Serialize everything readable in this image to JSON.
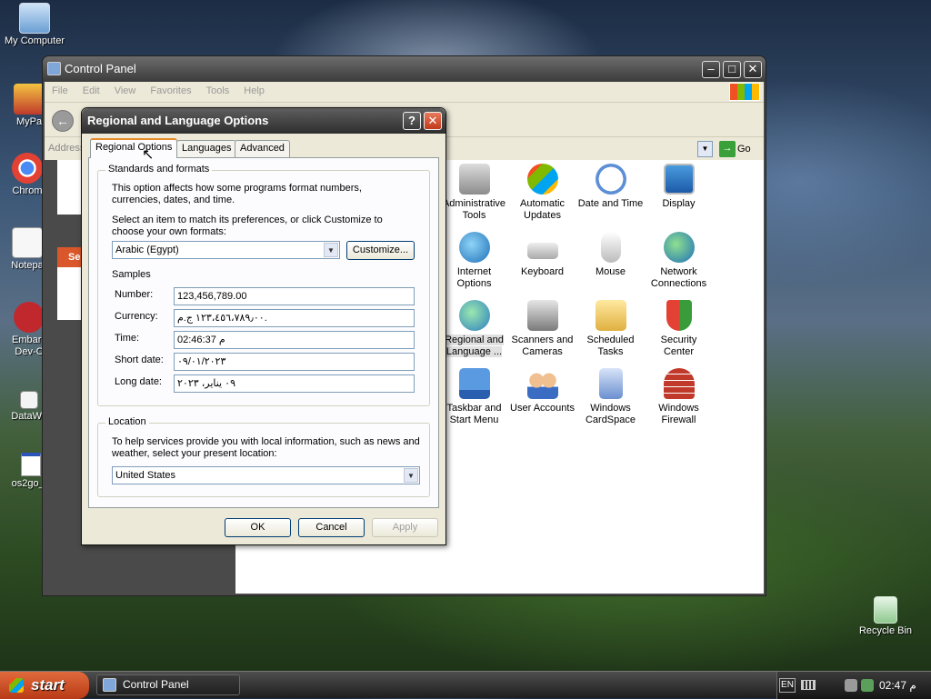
{
  "desktop": {
    "icons": [
      {
        "label": "My Computer"
      },
      {
        "label": "MyPa"
      },
      {
        "label": "Chrom"
      },
      {
        "label": "Notepa"
      },
      {
        "label": "Embarc"
      },
      {
        "label": "Dev-C"
      },
      {
        "label": "DataWa"
      },
      {
        "label": "os2go_tr"
      },
      {
        "label": "Recycle Bin"
      }
    ]
  },
  "control_panel": {
    "title": "Control Panel",
    "menu": [
      "File",
      "Edit",
      "View",
      "Favorites",
      "Tools",
      "Help"
    ],
    "address_label": "Address",
    "go_label": "Go",
    "left_partial": "Se",
    "items": [
      {
        "label": "Administrative Tools"
      },
      {
        "label": "Automatic Updates"
      },
      {
        "label": "Date and Time"
      },
      {
        "label": "Display"
      },
      {
        "label": "Internet Options"
      },
      {
        "label": "Keyboard"
      },
      {
        "label": "Mouse"
      },
      {
        "label": "Network Connections"
      },
      {
        "label": "Regional and Language ..."
      },
      {
        "label": "Scanners and Cameras"
      },
      {
        "label": "Scheduled Tasks"
      },
      {
        "label": "Security Center"
      },
      {
        "label": "Taskbar and Start Menu"
      },
      {
        "label": "User Accounts"
      },
      {
        "label": "Windows CardSpace"
      },
      {
        "label": "Windows Firewall"
      }
    ]
  },
  "dialog": {
    "title": "Regional and Language Options",
    "help_label": "?",
    "close_label": "✕",
    "tabs": [
      "Regional Options",
      "Languages",
      "Advanced"
    ],
    "standards": {
      "group_label": "Standards and formats",
      "desc": "This option affects how some programs format numbers, currencies, dates, and time.",
      "select_prompt": "Select an item to match its preferences, or click Customize to choose your own formats:",
      "selected_format": "Arabic (Egypt)",
      "customize_label": "Customize...",
      "samples_label": "Samples",
      "samples": [
        {
          "label": "Number:",
          "value": "123,456,789.00"
        },
        {
          "label": "Currency:",
          "value": "١٢٣،٤٥٦،٧٨٩٫٠٠ ج.م."
        },
        {
          "label": "Time:",
          "value": "02:46:37 م"
        },
        {
          "label": "Short date:",
          "value": "٠٩/٠١/٢٠٢٣"
        },
        {
          "label": "Long date:",
          "value": "٠٩ يناير، ٢٠٢٣"
        }
      ]
    },
    "location": {
      "group_label": "Location",
      "desc": "To help services provide you with local information, such as news and weather, select your present location:",
      "selected": "United States"
    },
    "buttons": {
      "ok": "OK",
      "cancel": "Cancel",
      "apply": "Apply"
    }
  },
  "taskbar": {
    "start_label": "start",
    "task_label": "Control Panel",
    "lang": "EN",
    "clock": "02:47 م"
  }
}
